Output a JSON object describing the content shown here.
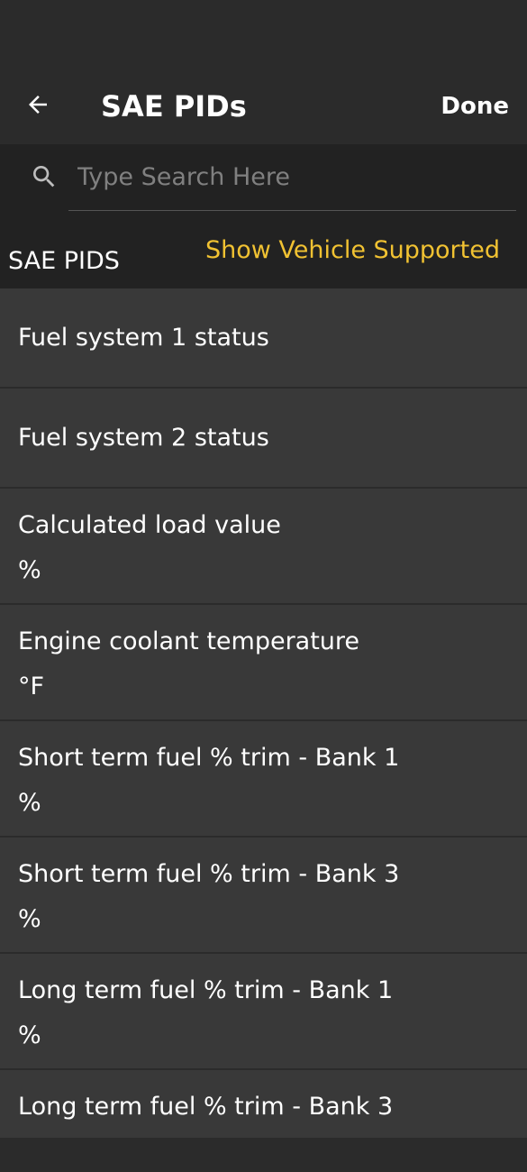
{
  "header": {
    "title": "SAE PIDs",
    "done_label": "Done",
    "back_icon": "arrow-left-icon"
  },
  "search": {
    "placeholder": "Type Search Here",
    "value": "",
    "icon": "search-icon"
  },
  "section": {
    "title": "SAE PIDS",
    "action_label": "Show Vehicle Supported",
    "action_color": "#f1c232"
  },
  "pids": [
    {
      "name": "Fuel system 1 status",
      "unit": ""
    },
    {
      "name": "Fuel system 2 status",
      "unit": ""
    },
    {
      "name": "Calculated load value",
      "unit": "%"
    },
    {
      "name": "Engine coolant temperature",
      "unit": "°F"
    },
    {
      "name": "Short term fuel % trim - Bank 1",
      "unit": "%"
    },
    {
      "name": "Short term fuel % trim - Bank 3",
      "unit": "%"
    },
    {
      "name": "Long term fuel % trim - Bank 1",
      "unit": "%"
    },
    {
      "name": "Long term fuel % trim - Bank 3",
      "unit": ""
    }
  ]
}
